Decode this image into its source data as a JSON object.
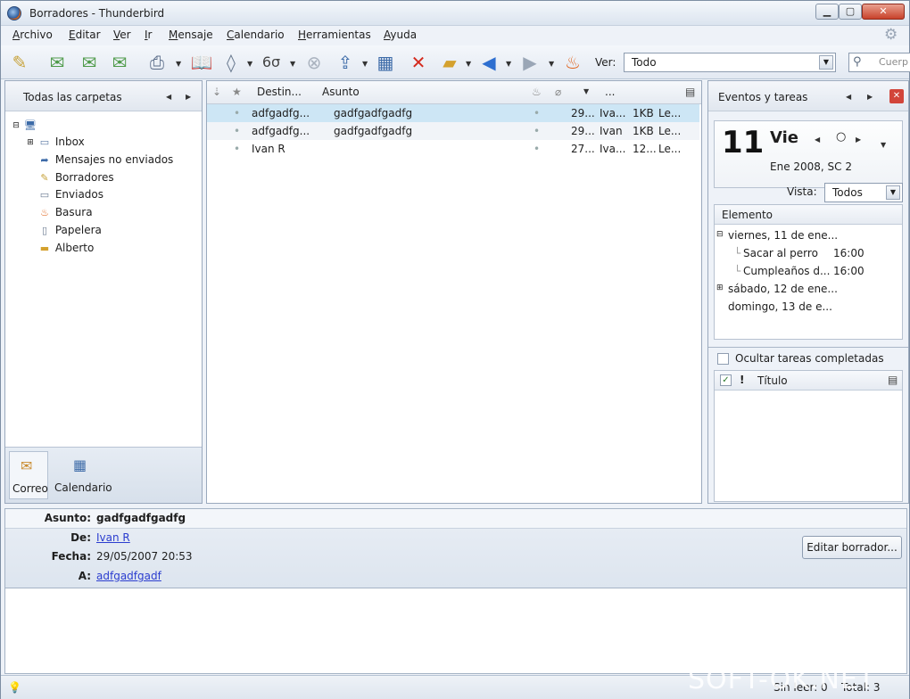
{
  "window": {
    "title": "Borradores - Thunderbird"
  },
  "menu": [
    "Archivo",
    "Editar",
    "Ver",
    "Ir",
    "Mensaje",
    "Calendario",
    "Herramientas",
    "Ayuda"
  ],
  "toolbar": {
    "ver_label": "Ver:",
    "ver_value": "Todo",
    "search_placeholder": "Cuerp"
  },
  "folders": {
    "header": "Todas las carpetas",
    "items": [
      {
        "label": "Inbox",
        "icon": "inbox-icon"
      },
      {
        "label": "Mensajes no enviados",
        "icon": "outbox-icon"
      },
      {
        "label": "Borradores",
        "icon": "drafts-icon"
      },
      {
        "label": "Enviados",
        "icon": "sent-icon"
      },
      {
        "label": "Basura",
        "icon": "junk-icon"
      },
      {
        "label": "Papelera",
        "icon": "trash-icon"
      },
      {
        "label": "Alberto",
        "icon": "folder-icon"
      }
    ],
    "modes": [
      {
        "label": "Correo",
        "icon": "mail-icon"
      },
      {
        "label": "Calendario",
        "icon": "calendar-icon"
      }
    ]
  },
  "messages": {
    "columns": {
      "recipient": "Destin...",
      "subject": "Asunto",
      "more": "..."
    },
    "rows": [
      {
        "recipient": "adfgadfg...",
        "subject": "gadfgadfgadfg",
        "date": "29...",
        "author": "Iva...",
        "size": "1KB",
        "status": "Le..."
      },
      {
        "recipient": "adfgadfg...",
        "subject": "gadfgadfgadfg",
        "date": "29...",
        "author": "Ivan",
        "size": "1KB",
        "status": "Le..."
      },
      {
        "recipient": "Ivan R",
        "subject": "",
        "date": "27...",
        "author": "Iva...",
        "size": "12...",
        "status": "Le..."
      }
    ]
  },
  "events": {
    "header": "Eventos y tareas",
    "day_number": "11",
    "weekday": "Vie",
    "month_week": "Ene 2008, SC 2",
    "vista_label": "Vista:",
    "vista_value": "Todos",
    "agenda_header": "Elemento",
    "agenda": [
      {
        "text": "viernes, 11 de ene..."
      },
      {
        "text": "Sacar al perro",
        "time": "16:00"
      },
      {
        "text": "Cumpleaños d...",
        "time": "16:00"
      },
      {
        "text": "sábado, 12 de ene..."
      },
      {
        "text": "domingo, 13 de e..."
      }
    ],
    "hide_completed_label": "Ocultar tareas completadas",
    "tasks_title_header": "Título"
  },
  "message_header": {
    "subject_label": "Asunto:",
    "subject_value": "gadfgadfgadfg",
    "from_label": "De:",
    "from_value": "Ivan R",
    "date_label": "Fecha:",
    "date_value": "29/05/2007 20:53",
    "to_label": "A:",
    "to_value": "adfgadfgadf",
    "edit_button": "Editar borrador..."
  },
  "status": {
    "unread": "Sin leer: 0",
    "total": "Total: 3"
  },
  "watermark": "SOFT-OK.NET",
  "colors": {
    "selected_row": "#cde6f5",
    "link": "#2b3dcf",
    "close": "#c8412a"
  }
}
